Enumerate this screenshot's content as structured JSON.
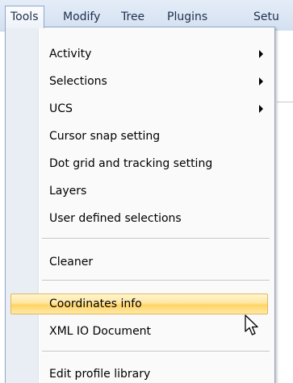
{
  "menubar": {
    "items": [
      {
        "label": "Tools",
        "active": true
      },
      {
        "label": "Modify",
        "active": false
      },
      {
        "label": "Tree",
        "active": false
      },
      {
        "label": "Plugins",
        "active": false
      },
      {
        "label": "Setu",
        "active": false
      }
    ]
  },
  "dropdown": {
    "items": [
      {
        "label": "Activity",
        "has_submenu": true
      },
      {
        "label": "Selections",
        "has_submenu": true
      },
      {
        "label": "UCS",
        "has_submenu": true
      },
      {
        "label": "Cursor snap setting",
        "has_submenu": false
      },
      {
        "label": "Dot grid and tracking setting",
        "has_submenu": false
      },
      {
        "label": "Layers",
        "has_submenu": false
      },
      {
        "label": "User defined selections",
        "has_submenu": false
      },
      {
        "label": "Cleaner",
        "has_submenu": false
      },
      {
        "label": "Coordinates info",
        "has_submenu": false,
        "highlighted": true
      },
      {
        "label": "XML IO Document",
        "has_submenu": false
      },
      {
        "label": "Edit profile library",
        "has_submenu": false
      }
    ],
    "submenu_icon": "triangle-right-icon",
    "cursor_icon": "mouse-pointer-icon"
  },
  "colors": {
    "menubar_bg": "#dce7f5",
    "highlight_bg": "#ffd465",
    "highlight_border": "#e2b85a",
    "gutter_bg": "#e9eef5",
    "menu_bg": "#fafafa",
    "text": "#000000"
  }
}
